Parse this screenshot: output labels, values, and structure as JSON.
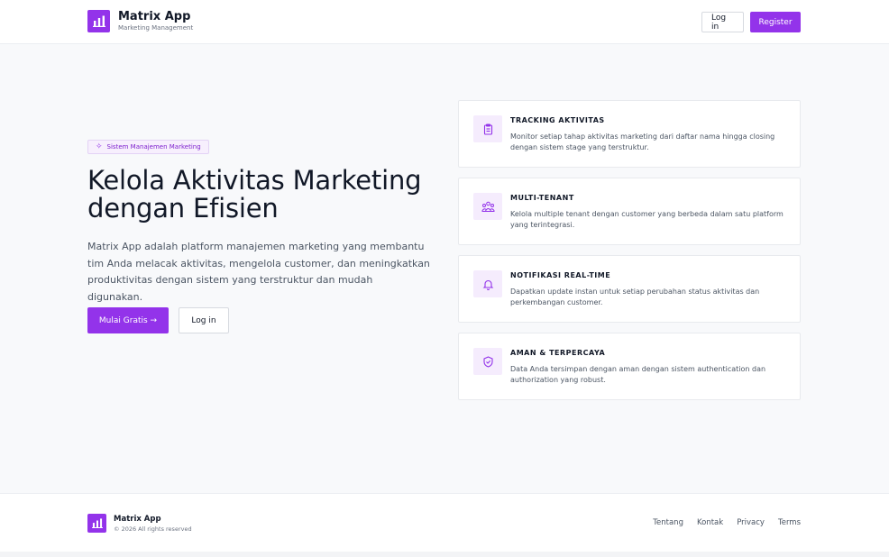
{
  "header": {
    "app_name": "Matrix App",
    "app_subtitle": "Marketing Management",
    "login_label": "Log in",
    "register_label": "Register",
    "logo_icon": "bar-chart-icon"
  },
  "hero": {
    "badge": "Sistem Manajemen Marketing",
    "badge_icon": "sparkle-icon",
    "title_line1": "Kelola Aktivitas Marketing",
    "title_line2": "dengan Efisien",
    "description": "Matrix App adalah platform manajemen marketing yang membantu tim Anda melacak aktivitas, mengelola customer, dan meningkatkan produktivitas dengan sistem yang terstruktur dan mudah digunakan.",
    "primary_cta": "Mulai Gratis →",
    "secondary_cta": "Log in"
  },
  "features": [
    {
      "icon": "clipboard-icon",
      "title": "TRACKING AKTIVITAS",
      "description": "Monitor setiap tahap aktivitas marketing dari daftar nama hingga closing dengan sistem stage yang terstruktur."
    },
    {
      "icon": "users-icon",
      "title": "MULTI-TENANT",
      "description": "Kelola multiple tenant dengan customer yang berbeda dalam satu platform yang terintegrasi."
    },
    {
      "icon": "bell-icon",
      "title": "NOTIFIKASI REAL-TIME",
      "description": "Dapatkan update instan untuk setiap perubahan status aktivitas dan perkembangan customer."
    },
    {
      "icon": "shield-check-icon",
      "title": "AMAN & TERPERCAYA",
      "description": "Data Anda tersimpan dengan aman dengan sistem authentication dan authorization yang robust."
    }
  ],
  "footer": {
    "app_name": "Matrix App",
    "copyright": "© 2026 All rights reserved",
    "links": [
      "Tentang",
      "Kontak",
      "Privacy",
      "Terms"
    ]
  },
  "colors": {
    "accent": "#9333ea",
    "accent_light": "#f5ecfd",
    "background": "#f8f9fb",
    "text": "#111827",
    "muted": "#4b5563"
  }
}
